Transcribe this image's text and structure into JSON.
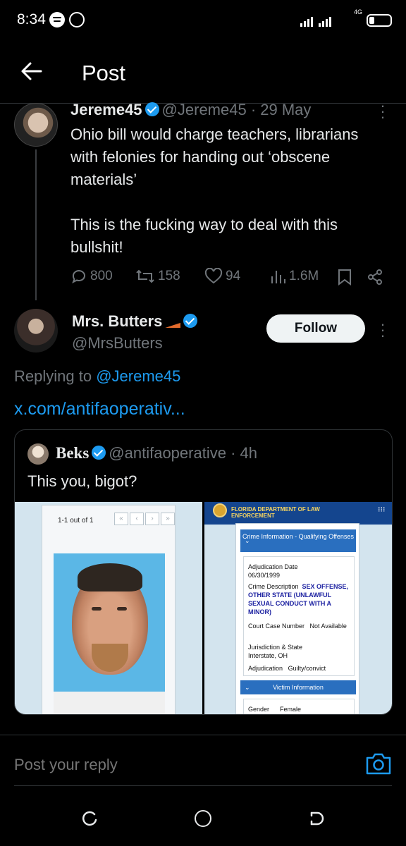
{
  "status_bar": {
    "time": "8:34",
    "network_type": "4G",
    "icons": [
      "spotify-icon",
      "whatsapp-icon",
      "signal-icon",
      "battery-icon"
    ]
  },
  "header": {
    "title": "Post",
    "back_icon": "arrow-left-icon"
  },
  "tweet": {
    "author_name": "Jereme45",
    "handle_date": "@Jereme45 · 29 May",
    "body": "Ohio bill would charge teachers, librarians with felonies for handing out ‘obscene materials’\n\nThis is the fucking way to deal with this bullshit!",
    "replies": "800",
    "reposts": "158",
    "likes": "94",
    "views": "1.6M"
  },
  "reply": {
    "author_name": "Mrs. Butters",
    "handle": "@MrsButters",
    "follow_label": "Follow",
    "replying_prefix": "Replying to",
    "replying_mention": "@Jereme45",
    "link": "x.com/antifaoperativ...",
    "quote": {
      "author_name": "Beks",
      "handle_time": "@antifaoperative · 4h",
      "text": "This you, bigot?",
      "left_image": {
        "pager": "1-1 out of 1",
        "pager_buttons": [
          "«",
          "‹",
          "›",
          "»"
        ]
      },
      "right_image": {
        "agency": "FLORIDA DEPARTMENT OF LAW ENFORCEMENT",
        "section1": "Crime Information - Qualifying Offenses",
        "adjudication_date_label": "Adjudication Date",
        "adjudication_date": "06/30/1999",
        "crime_desc_label": "Crime Description",
        "crime_desc": "SEX OFFENSE, OTHER STATE (UNLAWFUL SEXUAL CONDUCT WITH A MINOR)",
        "court_case_label": "Court Case Number",
        "court_case": "Not Available",
        "jurisdiction_label": "Jurisdiction & State",
        "jurisdiction": "Interstate, OH",
        "adjudication_label": "Adjudication",
        "adjudication": "Guilty/convict",
        "section2": "Victim Information",
        "gender_label": "Gender",
        "gender": "Female"
      }
    }
  },
  "reply_bar": {
    "placeholder": "Post your reply",
    "camera_icon": "camera-icon"
  },
  "nav_bar": {
    "icons": [
      "recent-apps-icon",
      "home-icon",
      "back-icon"
    ]
  },
  "colors": {
    "background": "#000000",
    "accent": "#1d9bf0",
    "secondary_text": "#71767b",
    "primary_text": "#e7e9ea"
  }
}
